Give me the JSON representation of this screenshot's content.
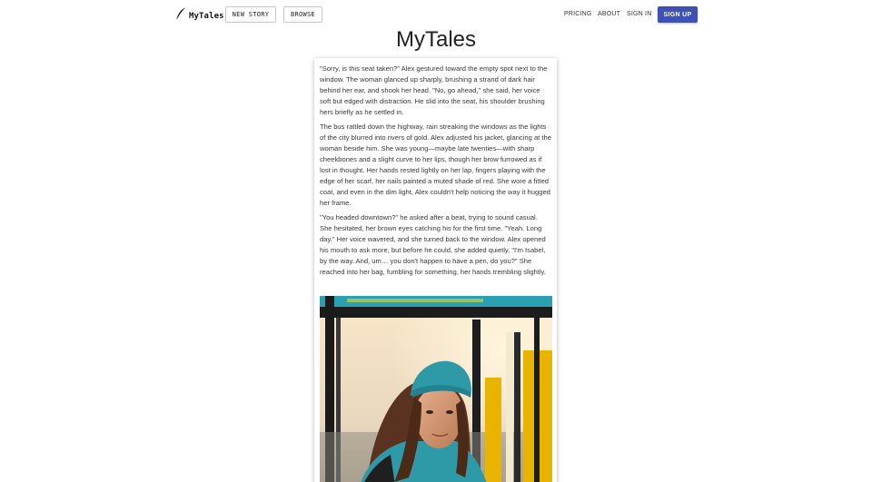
{
  "header": {
    "logo_text": "MyTales",
    "logo_icon": "quill-pen-icon",
    "new_story_label": "NEW STORY",
    "browse_label": "BROWSE",
    "pricing_label": "PRICING",
    "about_label": "ABOUT",
    "sign_in_label": "SIGN IN",
    "sign_up_label": "SIGN UP"
  },
  "page": {
    "title": "MyTales"
  },
  "story": {
    "paragraphs": [
      "\"Sorry, is this seat taken?\" Alex gestured toward the empty spot next to the window. The woman glanced up sharply, brushing a strand of dark hair behind her ear, and shook her head. \"No, go ahead,\" she said, her voice soft but edged with distraction. He slid into the seat, his shoulder brushing hers briefly as he settled in.",
      "The bus rattled down the highway, rain streaking the windows as the lights of the city blurred into rivers of gold. Alex adjusted his jacket, glancing at the woman beside him. She was young—maybe late twenties—with sharp cheekbones and a slight curve to her lips, though her brow furrowed as if lost in thought. Her hands rested lightly on her lap, fingers playing with the edge of her scarf, her nails painted a muted shade of red. She wore a fitted coat, and even in the dim light, Alex couldn't help noticing the way it hugged her frame.",
      "\"You headed downtown?\" he asked after a beat, trying to sound casual. She hesitated, her brown eyes catching his for the first time. \"Yeah. Long day.\" Her voice wavered, and she turned back to the window. Alex opened his mouth to ask more, but before he could, she added quietly, \"I'm Isabel, by the way. And, um… you don't happen to have a pen, do you?\" She reached into her bag, fumbling for something, her hands trembling slightly."
    ],
    "image_subject": "young woman with long brown hair in a teal knit beanie and teal hoodie sitting by a bus window, yellow poles, warm sunlight"
  },
  "colors": {
    "accent": "#3f51b5",
    "beanie": "#2e9aa8",
    "pole_yellow": "#e8b400"
  }
}
